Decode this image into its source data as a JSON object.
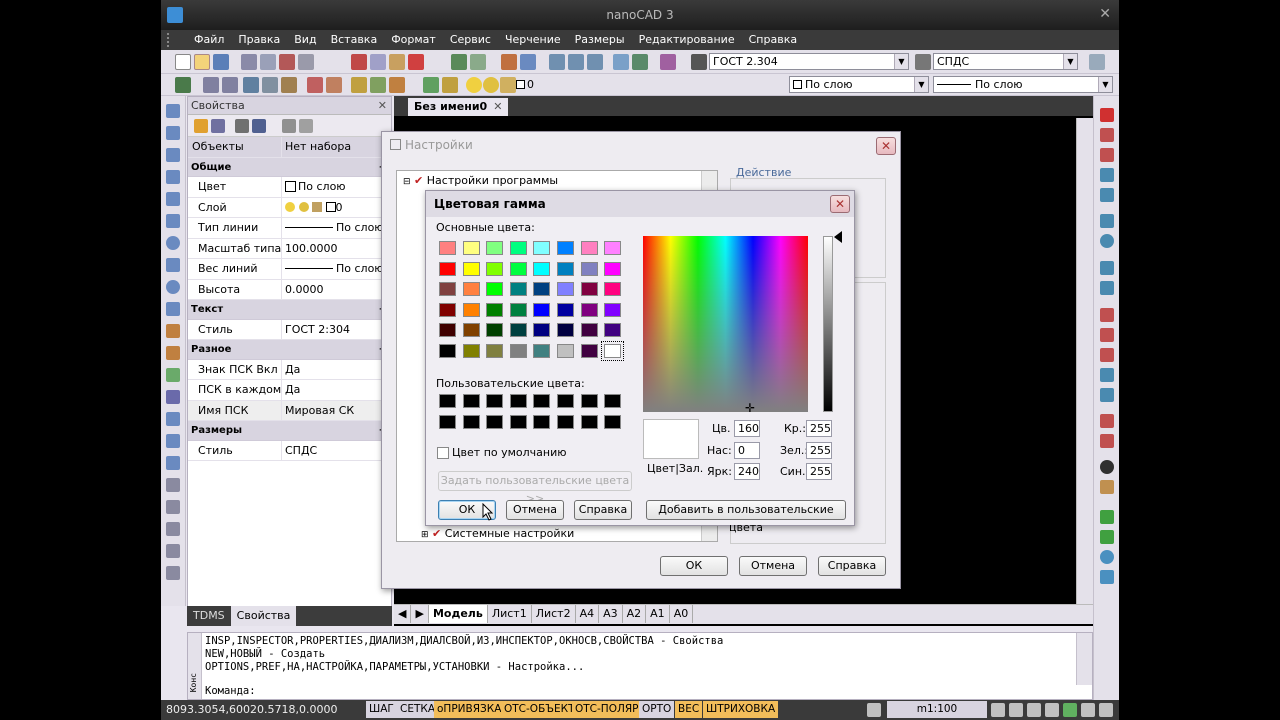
{
  "app": {
    "title": "nanoCAD 3",
    "menu": [
      "Файл",
      "Правка",
      "Вид",
      "Вставка",
      "Формат",
      "Сервис",
      "Черчение",
      "Размеры",
      "Редактирование",
      "Справка"
    ]
  },
  "toolbar": {
    "text_style": "ГОСТ 2.304",
    "dim_style": "СПДС",
    "layer_value": "0",
    "linetype": "По слою",
    "lineweight": "По слою"
  },
  "properties": {
    "title": "Свойства",
    "object_label": "Объекты",
    "object_value": "Нет набора",
    "cat_general": "Общие",
    "cat_text": "Текст",
    "cat_misc": "Разное",
    "cat_dims": "Размеры",
    "color_k": "Цвет",
    "color_v": "По слою",
    "layer_k": "Слой",
    "layer_v": "0",
    "ltype_k": "Тип линии",
    "ltype_v": "По слою",
    "ltscale_k": "Масштаб типа ...",
    "ltscale_v": "100.0000",
    "lweight_k": "Вес линий",
    "lweight_v": "По слою",
    "height_k": "Высота",
    "height_v": "0.0000",
    "tstyle_k": "Стиль",
    "tstyle_v": "ГОСТ 2:304",
    "ucsicon_k": "Знак ПСК Вкл",
    "ucsicon_v": "Да",
    "ucsall_k": "ПСК в каждом ...",
    "ucsall_v": "Да",
    "ucsname_k": "Имя ПСК",
    "ucsname_v": "Мировая СК",
    "dstyle_k": "Стиль",
    "dstyle_v": "СПДС",
    "tab_tdms": "TDMS",
    "tab_props": "Свойства"
  },
  "document": {
    "tab_title": "Без имени0",
    "layouts": [
      "Модель",
      "Лист1",
      "Лист2",
      "А4",
      "А3",
      "А2",
      "А1",
      "А0"
    ]
  },
  "settings_dialog": {
    "title": "Настройки",
    "tree_root": "Настройки программы",
    "tree_last": "Системные настройки",
    "action_label": "Действие",
    "ok": "ОК",
    "cancel": "Отмена",
    "help": "Справка"
  },
  "color_dialog": {
    "title": "Цветовая гамма",
    "basic_label": "Основные цвета:",
    "custom_label": "Пользовательские цвета:",
    "default_color": "Цвет по умолчанию",
    "define_custom": "Задать пользовательские цвета >>",
    "hue_label": "Цв.",
    "hue": "160",
    "sat_label": "Нас:",
    "sat": "0",
    "lum_label": "Ярк:",
    "lum": "240",
    "red_label": "Кр.:",
    "red": "255",
    "green_label": "Зел.:",
    "green": "255",
    "blue_label": "Син.:",
    "blue": "255",
    "color_solid": "Цвет|Зал.",
    "ok": "ОК",
    "cancel": "Отмена",
    "help": "Справка",
    "add_custom": "Добавить в пользовательские цвета",
    "basic_colors": [
      "#ff8080",
      "#ffff80",
      "#80ff80",
      "#00ff80",
      "#80ffff",
      "#0080ff",
      "#ff80c0",
      "#ff80ff",
      "#ff0000",
      "#ffff00",
      "#80ff00",
      "#00ff40",
      "#00ffff",
      "#0080c0",
      "#8080c0",
      "#ff00ff",
      "#804040",
      "#ff8040",
      "#00ff00",
      "#008080",
      "#004080",
      "#8080ff",
      "#800040",
      "#ff0080",
      "#800000",
      "#ff8000",
      "#008000",
      "#008040",
      "#0000ff",
      "#0000a0",
      "#800080",
      "#8000ff",
      "#400000",
      "#804000",
      "#004000",
      "#004040",
      "#000080",
      "#000040",
      "#400040",
      "#400080",
      "#000000",
      "#808000",
      "#808040",
      "#808080",
      "#408080",
      "#c0c0c0",
      "#400040",
      "#ffffff"
    ],
    "selected_color": "#ffffff"
  },
  "command": {
    "lines": [
      "INSP,INSPECTOR,PROPERTIES,ДИАЛИЗМ,ДИАЛСВОЙ,ИЗ,ИНСПЕКТОР,ОКНОСВ,СВОЙСТВА - Свойства",
      "NEW,НОВЫЙ - Создать",
      "OPTIONS,PREF,НА,НАСТРОЙКА,ПАРАМЕТРЫ,УСТАНОВКИ - Настройка..."
    ],
    "prompt": "Команда:",
    "side_label": "Конс"
  },
  "status": {
    "coords": "8093.3054,60020.5718,0.0000",
    "buttons": [
      "ШАГ",
      "СЕТКА",
      "оПРИВЯЗКА",
      "ОТС-ОБЪЕКТ",
      "ОТС-ПОЛЯР",
      "ОРТО",
      "ВЕС",
      "ШТРИХОВКА"
    ],
    "scale": "m1:100"
  }
}
